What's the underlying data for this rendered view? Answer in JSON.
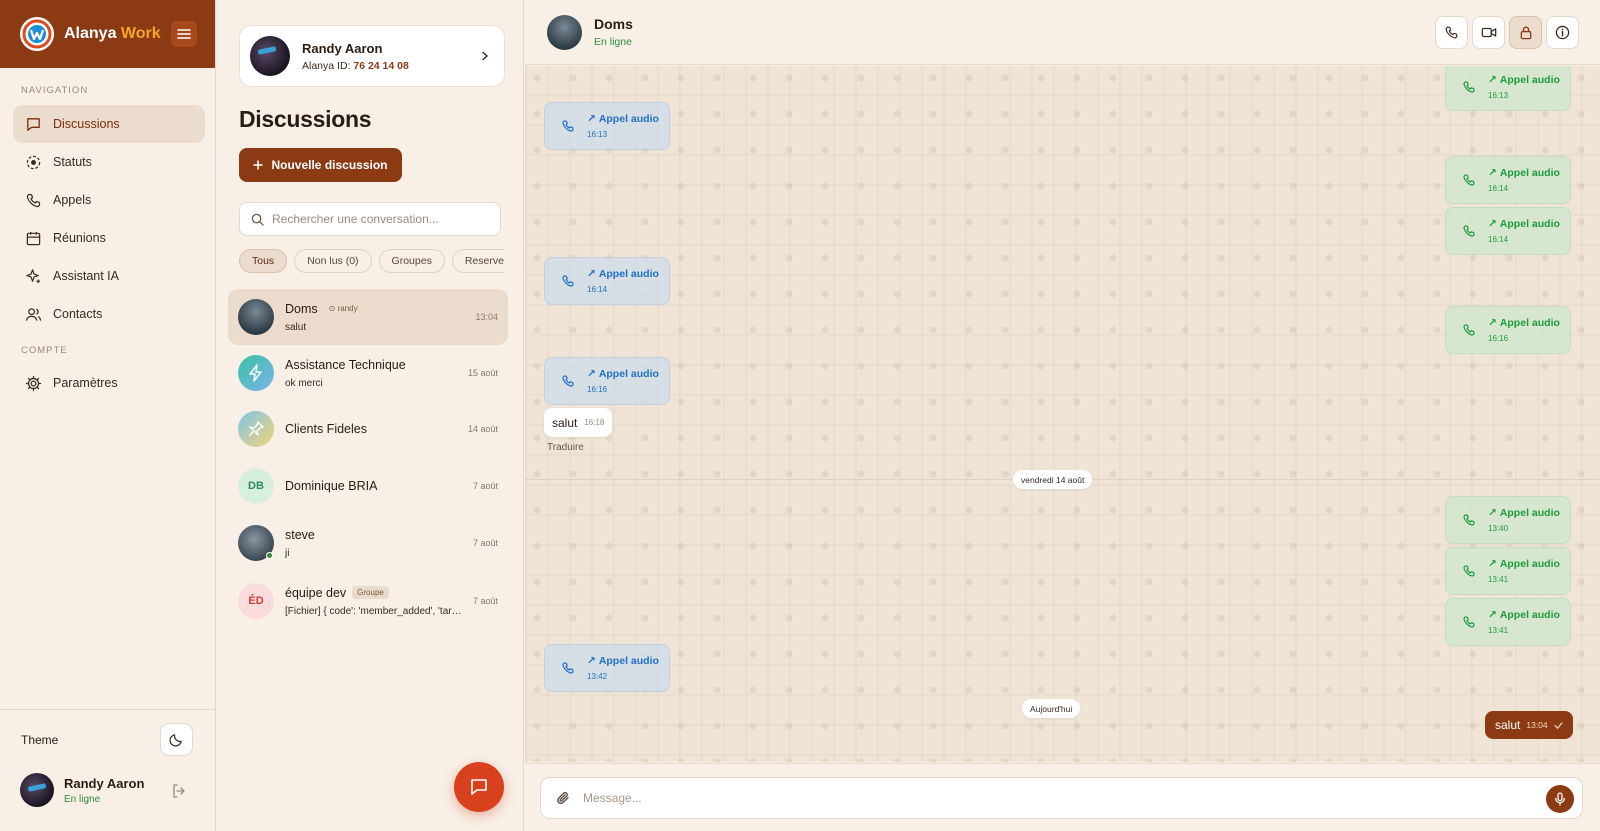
{
  "brand": {
    "name_a": "Alanya ",
    "name_b": "Work"
  },
  "nav": {
    "section_label": "Navigation",
    "items": [
      {
        "label": "Discussions",
        "icon": "chat-icon"
      },
      {
        "label": "Statuts",
        "icon": "status-icon"
      },
      {
        "label": "Appels",
        "icon": "phone-icon"
      },
      {
        "label": "Réunions",
        "icon": "calendar-icon"
      },
      {
        "label": "Assistant IA",
        "icon": "sparkle-icon"
      },
      {
        "label": "Contacts",
        "icon": "users-icon"
      }
    ],
    "account_label": "Compte",
    "account_items": [
      {
        "label": "Paramètres",
        "icon": "gear-icon"
      }
    ],
    "theme_label": "Theme"
  },
  "user": {
    "name": "Randy Aaron",
    "status": "En ligne",
    "id_label": "Alanya ID: ",
    "id_value": "76 24 14 08"
  },
  "list": {
    "title": "Discussions",
    "new_button": "Nouvelle discussion",
    "search_placeholder": "Rechercher une conversation...",
    "filters": [
      "Tous",
      "Non lus (0)",
      "Groupes",
      "Reserve"
    ],
    "conversations": [
      {
        "name": "Doms",
        "tag": "randy",
        "preview": "salut",
        "time": "13:04"
      },
      {
        "name": "Assistance Technique",
        "tag": "",
        "preview": "ok merci",
        "time": "15 août"
      },
      {
        "name": "Clients Fideles",
        "tag": "",
        "preview": "",
        "time": "14 août"
      },
      {
        "name": "Dominique BRIA",
        "tag": "",
        "preview": "",
        "time": "7 août",
        "initials": "DB"
      },
      {
        "name": "steve",
        "tag": "",
        "preview": "ji",
        "time": "7 août"
      },
      {
        "name": "équipe dev",
        "tag": "Groupe",
        "preview": "[Fichier] { code': 'member_added', 'targ...",
        "time": "7 août",
        "initials": "ÉD"
      }
    ]
  },
  "chat": {
    "contact_name": "Doms",
    "contact_status": "En ligne",
    "calls_in": [
      {
        "label": "Appel audio",
        "time": "16:13"
      },
      {
        "label": "Appel audio",
        "time": "16:14"
      },
      {
        "label": "Appel audio",
        "time": "16:16"
      },
      {
        "label": "Appel audio",
        "time": "13:42"
      }
    ],
    "calls_out": [
      {
        "label": "Appel audio",
        "time": "16:13"
      },
      {
        "label": "Appel audio",
        "time": "16:14"
      },
      {
        "label": "Appel audio",
        "time": "16:14"
      },
      {
        "label": "Appel audio",
        "time": "16:16"
      },
      {
        "label": "Appel audio",
        "time": "13:40"
      },
      {
        "label": "Appel audio",
        "time": "13:41"
      },
      {
        "label": "Appel audio",
        "time": "13:41"
      }
    ],
    "incoming_msg": {
      "text": "salut",
      "time": "16:18"
    },
    "translate": "Traduire",
    "date_sep_1": "vendredi 14 août",
    "date_sep_2": "Aujourd'hui",
    "outgoing_msg": {
      "text": "salut",
      "time": "13:04"
    },
    "composer_placeholder": "Message..."
  },
  "colors": {
    "brand": "#8c3a14",
    "accent_orange": "#d9411e",
    "online": "#2e8b3e",
    "call_in": "#1f6fc4",
    "call_out": "#1e9a3e"
  }
}
